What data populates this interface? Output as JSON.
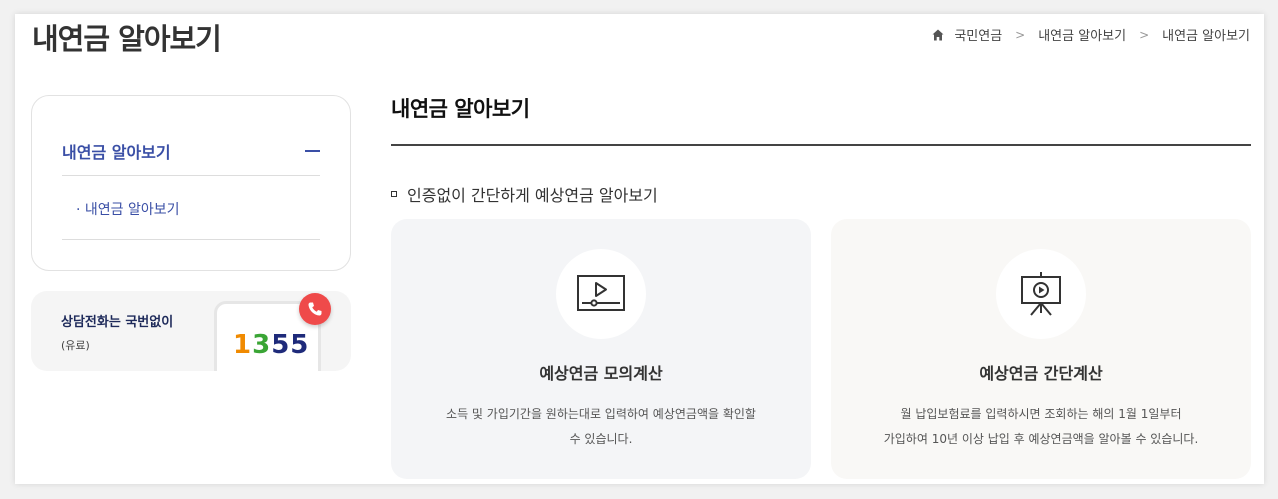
{
  "header": {
    "title": "내연금 알아보기",
    "breadcrumb": [
      "국민연금",
      "내연금 알아보기",
      "내연금 알아보기"
    ]
  },
  "sidebar": {
    "section_label": "내연금 알아보기",
    "items": [
      {
        "label": "· 내연금 알아보기"
      }
    ]
  },
  "call": {
    "title": "상담전화는 국번없이",
    "note": "(유료)",
    "number_parts": [
      "1",
      "3",
      "55"
    ]
  },
  "content": {
    "title": "내연금 알아보기",
    "section_label": "인증없이 간단하게 예상연금 알아보기",
    "cards": [
      {
        "icon": "video-play-icon",
        "title": "예상연금 모의계산",
        "desc_lines": [
          "소득 및 가입기간을 원하는대로 입력하여 예상연금액을 확인할",
          "수 있습니다."
        ]
      },
      {
        "icon": "presentation-play-icon",
        "title": "예상연금 간단계산",
        "desc_lines": [
          "월 납입보험료를 입력하시면 조회하는 해의 1월 1일부터",
          "가입하여 10년 이상 납입 후 예상연금액을 알아볼 수 있습니다."
        ]
      }
    ]
  },
  "colors": {
    "accent": "#3a4fa6",
    "badge": "#ef4a4a"
  }
}
